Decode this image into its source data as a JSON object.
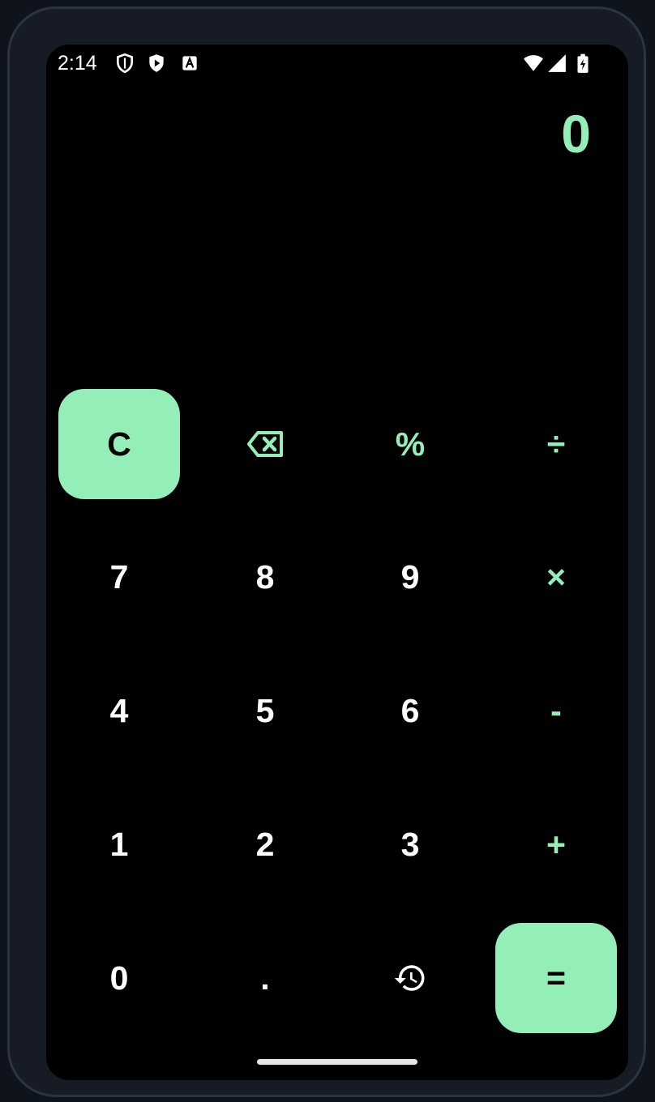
{
  "status_bar": {
    "time": "2:14",
    "left_icons": [
      "shield-icon",
      "play-protect-icon",
      "a-badge-icon"
    ],
    "right_icons": [
      "wifi-icon",
      "signal-icon",
      "battery-charging-icon"
    ]
  },
  "display": {
    "value": "0"
  },
  "keypad": {
    "clear": "C",
    "backspace_icon": "backspace-icon",
    "percent": "%",
    "divide": "÷",
    "seven": "7",
    "eight": "8",
    "nine": "9",
    "multiply": "×",
    "four": "4",
    "five": "5",
    "six": "6",
    "minus": "-",
    "one": "1",
    "two": "2",
    "three": "3",
    "plus": "+",
    "zero": "0",
    "decimal": ".",
    "history_icon": "history-icon",
    "equals": "="
  },
  "colors": {
    "accent": "#93eeb8",
    "screen_background": "#000000",
    "digit_text": "#ffffff",
    "device_frame": "#161b25"
  }
}
